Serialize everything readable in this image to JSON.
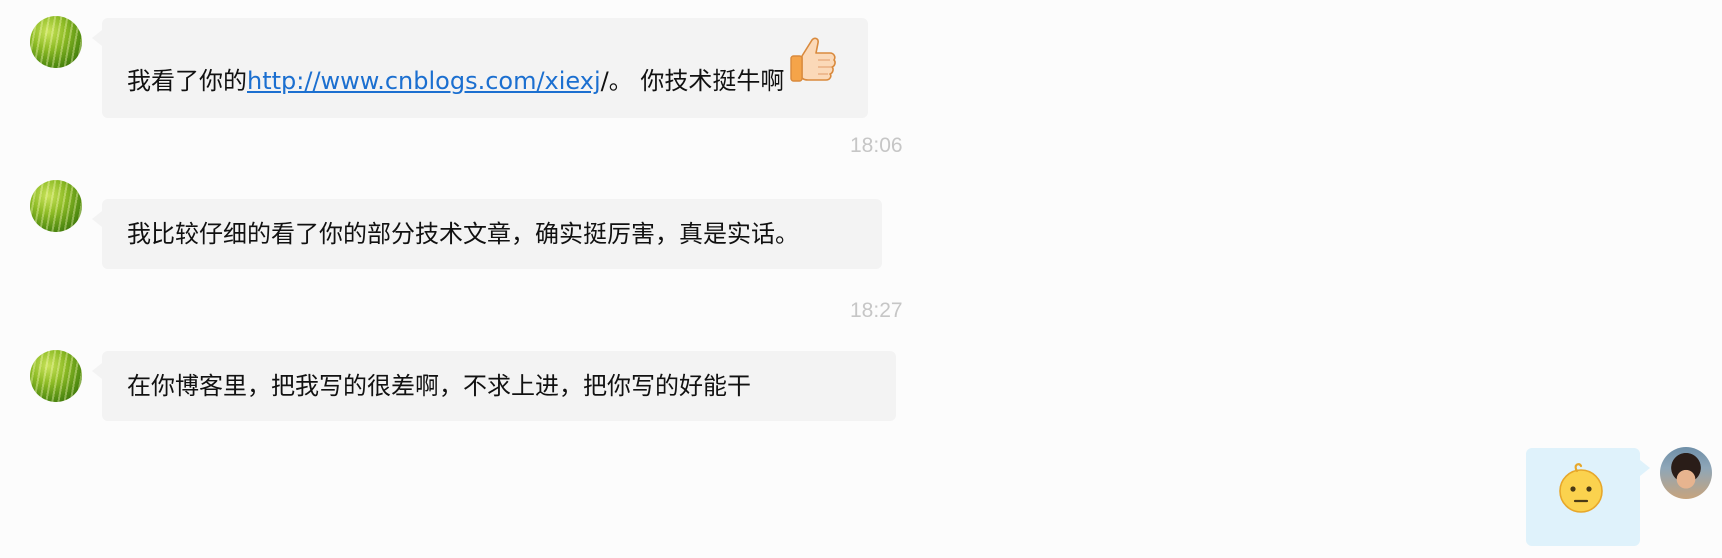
{
  "messages": [
    {
      "side": "left",
      "text_before": "我看了你的",
      "link": "http://www.cnblogs.com/xiexj",
      "text_after": "/。 你技术挺牛啊",
      "emoji": "thumbs-up-icon"
    },
    {
      "side": "left",
      "timestamp": "18:06",
      "text": "我比较仔细的看了你的部分技术文章，确实挺厉害，真是实话。"
    },
    {
      "side": "left",
      "timestamp": "18:27",
      "text": "在你博客里，把我写的很差啊，不求上进，把你写的好能干"
    },
    {
      "side": "right",
      "emoji": "confused-face-icon"
    }
  ],
  "colors": {
    "bubble_left": "#f3f3f3",
    "bubble_right": "#dff2fb",
    "link": "#1b6fd0",
    "timestamp": "#c6c6c6",
    "background": "#fcfcfc"
  }
}
